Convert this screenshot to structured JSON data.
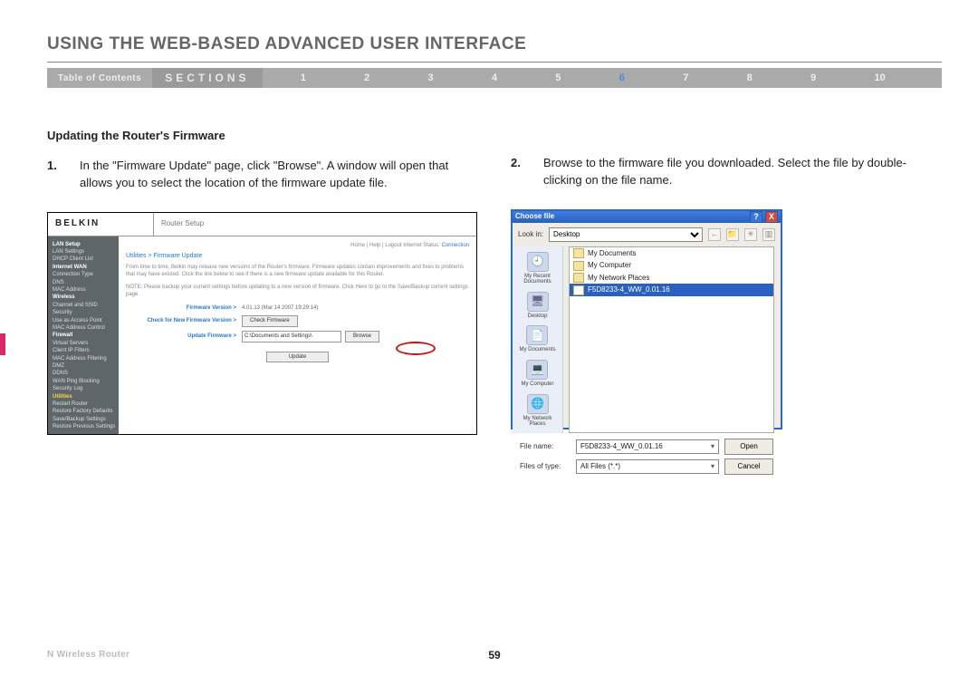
{
  "page": {
    "title": "USING THE WEB-BASED ADVANCED USER INTERFACE",
    "toc_label": "Table of Contents",
    "sections_label": "SECTIONS",
    "section_numbers": [
      "1",
      "2",
      "3",
      "4",
      "5",
      "6",
      "7",
      "8",
      "9",
      "10"
    ],
    "active_section_index": 5,
    "subheading": "Updating the Router's Firmware",
    "step1": {
      "num": "1.",
      "text": "In the \"Firmware Update\" page, click \"Browse\". A window will open that allows you to select the location of the firmware update file."
    },
    "step2": {
      "num": "2.",
      "text": "Browse to the firmware file you downloaded. Select the file by double-clicking on the file name."
    },
    "footer_product": "N Wireless Router",
    "page_number": "59"
  },
  "router_ui": {
    "brand": "BELKIN",
    "brand_sub": "Router Setup",
    "header_links": "Home | Help | Logout   Internet Status:",
    "status_value": "Connection",
    "sidebar_groups": [
      {
        "hdr": "LAN Setup",
        "items": [
          "LAN Settings",
          "DHCP Client List"
        ]
      },
      {
        "hdr": "Internet WAN",
        "items": [
          "Connection Type",
          "DNS",
          "MAC Address"
        ]
      },
      {
        "hdr": "Wireless",
        "items": [
          "Channel and SSID",
          "Security",
          "Use as Access Point",
          "MAC Address Control"
        ]
      },
      {
        "hdr": "Firewall",
        "items": [
          "Virtual Servers",
          "Client IP Filters",
          "MAC Address Filtering",
          "DMZ",
          "DDNS",
          "WAN Ping Blocking",
          "Security Log"
        ]
      },
      {
        "hdr_uti": "Utilities",
        "items": [
          "Restart Router",
          "Restore Factory Defaults",
          "Save/Backup Settings",
          "Restore Previous Settings"
        ]
      }
    ],
    "crumb": "Utilities > Firmware Update",
    "para1": "From time to time, Belkin may release new versions of the Router's firmware. Firmware updates contain improvements and fixes to problems that may have existed. Click the link below to see if there is a new firmware update available for this Router.",
    "para2": "NOTE: Please backup your current settings before updating to a new version of firmware. Click Here to go to the Save/Backup current settings page.",
    "row_firmware_version_lbl": "Firmware Version >",
    "row_firmware_version_val": "4.01.13 (Mar 14 2007 19:29:14)",
    "row_check_lbl": "Check for New Firmware Version >",
    "row_check_btn": "Check Firmware",
    "row_update_lbl": "Update Firmware >",
    "row_update_path": "C:\\Documents and Settings\\",
    "row_update_browse": "Browse",
    "row_update_btn": "Update"
  },
  "file_dialog": {
    "title": "Choose file",
    "lookin_label": "Look in:",
    "lookin_value": "Desktop",
    "places": [
      "My Recent Documents",
      "Desktop",
      "My Documents",
      "My Computer",
      "My Network Places"
    ],
    "list_items": [
      {
        "label": "My Documents",
        "sel": false
      },
      {
        "label": "My Computer",
        "sel": false
      },
      {
        "label": "My Network Places",
        "sel": false
      },
      {
        "label": "F5D8233-4_WW_0.01.16",
        "sel": true
      }
    ],
    "filename_label": "File name:",
    "filename_value": "F5D8233-4_WW_0.01.16",
    "filetype_label": "Files of type:",
    "filetype_value": "All Files (*.*)",
    "open_btn": "Open",
    "cancel_btn": "Cancel",
    "help_glyph": "?",
    "close_glyph": "X"
  }
}
